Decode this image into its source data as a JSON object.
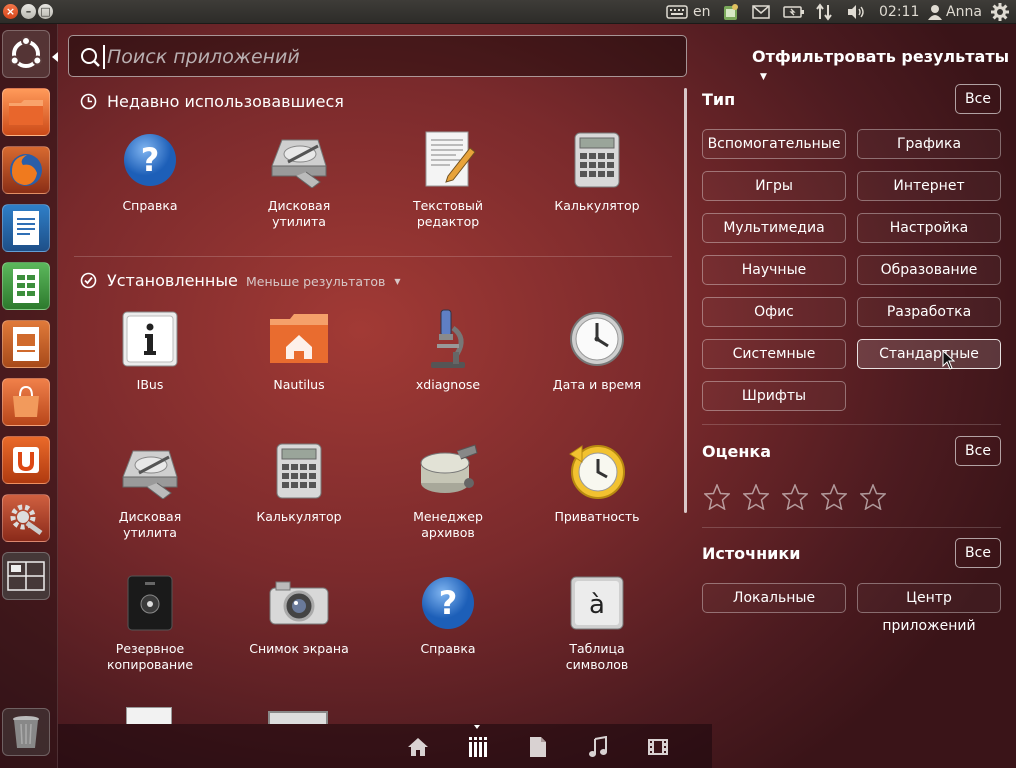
{
  "topbar": {
    "keyboard_layout": "en",
    "time": "02:11",
    "user": "Anna",
    "icons": [
      "keyboard-icon",
      "app-indicator-icon",
      "mail-icon",
      "battery-icon",
      "network-icon",
      "volume-icon",
      "user-icon",
      "gear-icon"
    ]
  },
  "window_buttons": [
    "close",
    "minimize",
    "maximize"
  ],
  "launcher": {
    "items": [
      "ubuntu-dash",
      "files",
      "firefox",
      "writer",
      "calc",
      "impress",
      "software-center",
      "ubuntu-one",
      "system-settings",
      "workspace-switcher",
      "trash"
    ]
  },
  "search": {
    "placeholder": "Поиск приложений",
    "value": ""
  },
  "recent": {
    "title": "Недавно использовавшиеся",
    "apps": [
      {
        "line1": "Справка",
        "line2": "",
        "icon": "help-icon"
      },
      {
        "line1": "Дисковая",
        "line2": "утилита",
        "icon": "disk-utility-icon"
      },
      {
        "line1": "Текстовый",
        "line2": "редактор",
        "icon": "text-editor-icon"
      },
      {
        "line1": "Калькулятор",
        "line2": "",
        "icon": "calculator-icon"
      }
    ]
  },
  "installed": {
    "title": "Установленные",
    "fewer_results": "Меньше результатов",
    "apps": [
      {
        "line1": "IBus",
        "line2": "",
        "icon": "ibus-icon"
      },
      {
        "line1": "Nautilus",
        "line2": "",
        "icon": "home-folder-icon"
      },
      {
        "line1": "xdiagnose",
        "line2": "",
        "icon": "microscope-icon"
      },
      {
        "line1": "Дата и время",
        "line2": "",
        "icon": "clock-icon"
      },
      {
        "line1": "Дисковая",
        "line2": "утилита",
        "icon": "disk-utility-icon"
      },
      {
        "line1": "Калькулятор",
        "line2": "",
        "icon": "calculator-icon"
      },
      {
        "line1": "Менеджер",
        "line2": "архивов",
        "icon": "archive-manager-icon"
      },
      {
        "line1": "Приватность",
        "line2": "",
        "icon": "privacy-icon"
      },
      {
        "line1": "Резервное",
        "line2": "копирование",
        "icon": "backup-icon"
      },
      {
        "line1": "Снимок экрана",
        "line2": "",
        "icon": "camera-icon"
      },
      {
        "line1": "Справка",
        "line2": "",
        "icon": "help-icon"
      },
      {
        "line1": "Таблица",
        "line2": "символов",
        "icon": "character-map-icon"
      }
    ]
  },
  "filters": {
    "title": "Отфильтровать результаты",
    "type": {
      "title": "Тип",
      "all_label": "Все",
      "options": [
        "Вспомогательные",
        "Графика",
        "Игры",
        "Интернет",
        "Мультимедиа",
        "Настройка",
        "Научные",
        "Образование",
        "Офис",
        "Разработка",
        "Системные",
        "Стандартные",
        "Шрифты"
      ],
      "selected": "Стандартные"
    },
    "rating": {
      "title": "Оценка",
      "all_label": "Все",
      "stars": 5,
      "selected_stars": 0
    },
    "sources": {
      "title": "Источники",
      "all_label": "Все",
      "options": [
        "Локальные",
        "Центр приложений"
      ]
    }
  },
  "lens_bar": {
    "items": [
      "home-lens-icon",
      "applications-lens-icon",
      "files-lens-icon",
      "music-lens-icon",
      "video-lens-icon"
    ],
    "active": "applications-lens-icon"
  }
}
